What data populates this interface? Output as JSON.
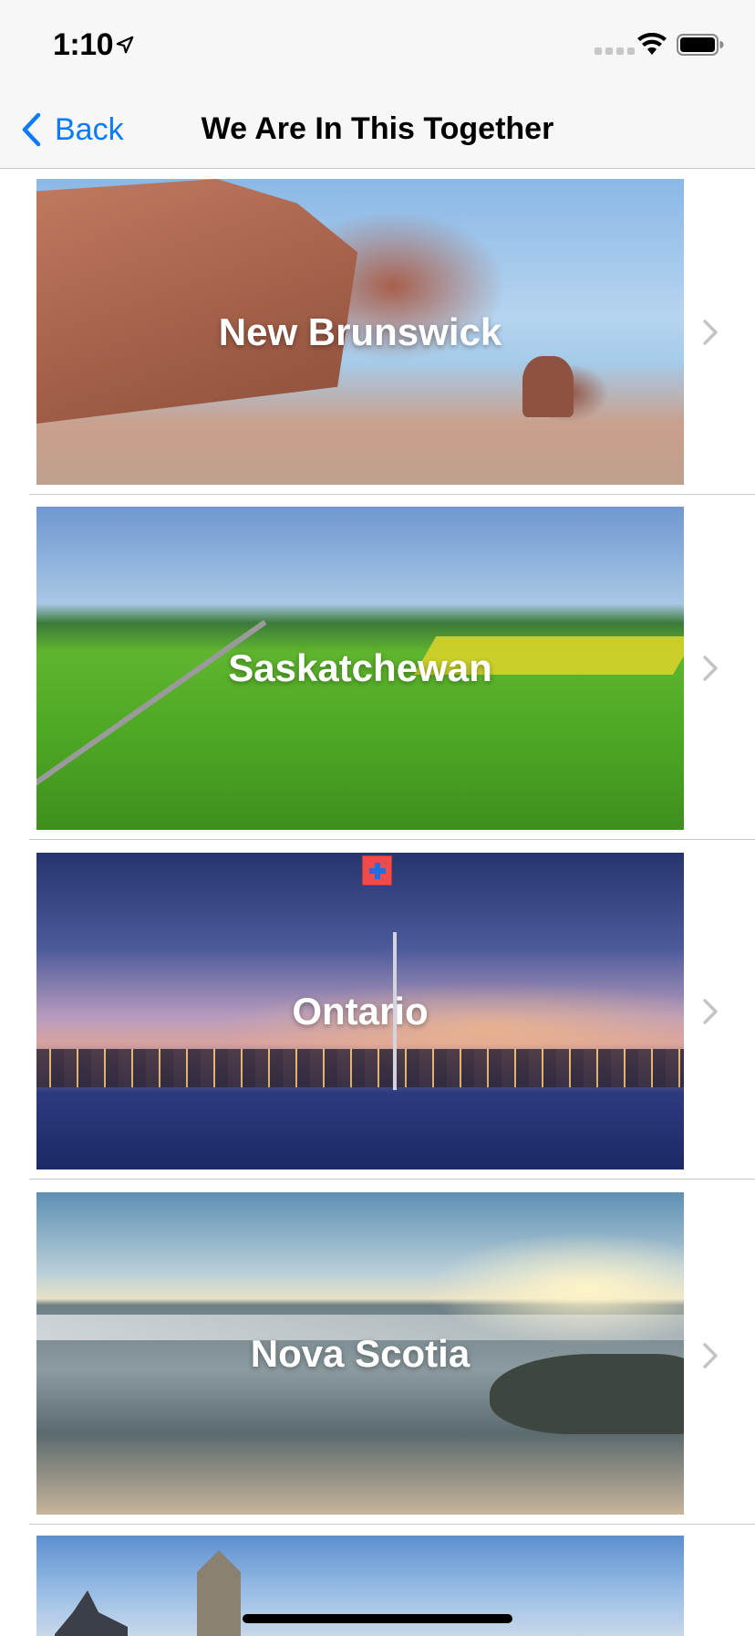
{
  "status_bar": {
    "time": "1:10"
  },
  "nav": {
    "back_label": "Back",
    "title": "We Are In This Together"
  },
  "rows": [
    {
      "label": "New Brunswick"
    },
    {
      "label": "Saskatchewan"
    },
    {
      "label": "Ontario"
    },
    {
      "label": "Nova Scotia"
    },
    {
      "label": ""
    }
  ],
  "colors": {
    "accent": "#0a7aff",
    "separator": "#c8c8cc",
    "chevron": "#c4c4c7",
    "badge": "#ef4b4b"
  },
  "icons": [
    "location-arrow-icon",
    "signal-icon",
    "wifi-icon",
    "battery-icon",
    "back-chevron-icon",
    "disclosure-chevron-icon",
    "plus-icon"
  ]
}
